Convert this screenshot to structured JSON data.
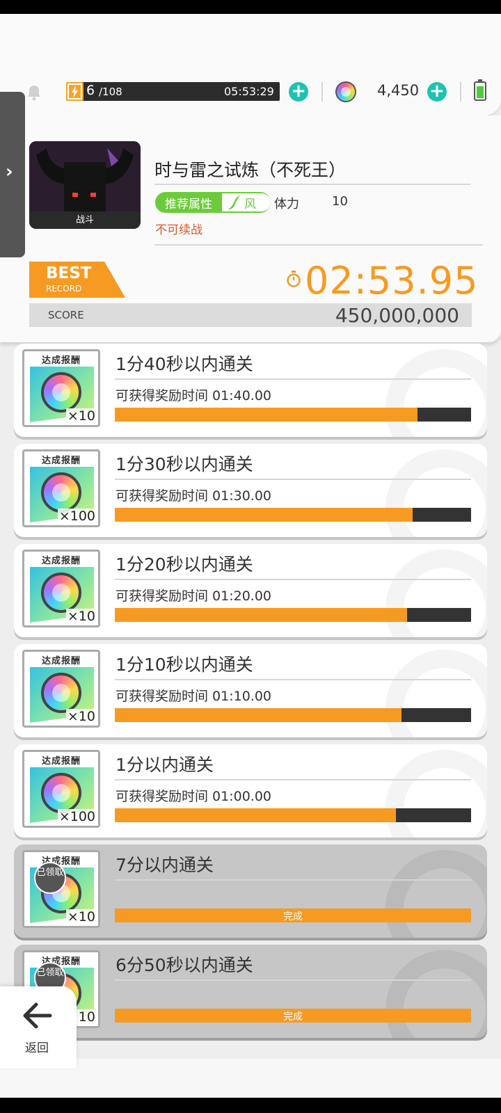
{
  "topbar": {
    "stamina_current": "6",
    "stamina_max": "/108",
    "stamina_timer": "05:53:29",
    "gems": "4,450"
  },
  "stage": {
    "thumbnail_caption": "战斗",
    "title": "时与雷之试炼（不死王）",
    "recommended_attr_label": "推荐属性",
    "recommended_attr_value": "风",
    "stamina_label": "体力",
    "stamina_cost": "10",
    "continue_notice": "不可续战"
  },
  "best": {
    "badge_line1": "BEST",
    "badge_line2": "RECORD",
    "time": "02:53.95",
    "score_label": "SCORE",
    "score": "450,000,000"
  },
  "missions": [
    {
      "reward_header": "达成报酬",
      "qty": "×10",
      "title": "1分40秒以内通关",
      "sub": "可获得奖励时间 01:40.00",
      "progress": 0.85,
      "done": false
    },
    {
      "reward_header": "达成报酬",
      "qty": "×100",
      "title": "1分30秒以内通关",
      "sub": "可获得奖励时间 01:30.00",
      "progress": 0.835,
      "done": false
    },
    {
      "reward_header": "达成报酬",
      "qty": "×10",
      "title": "1分20秒以内通关",
      "sub": "可获得奖励时间 01:20.00",
      "progress": 0.82,
      "done": false
    },
    {
      "reward_header": "达成报酬",
      "qty": "×10",
      "title": "1分10秒以内通关",
      "sub": "可获得奖励时间 01:10.00",
      "progress": 0.805,
      "done": false
    },
    {
      "reward_header": "达成报酬",
      "qty": "×100",
      "title": "1分以内通关",
      "sub": "可获得奖励时间 01:00.00",
      "progress": 0.79,
      "done": false
    },
    {
      "reward_header": "达成报酬",
      "qty": "×10",
      "title": "7分以内通关",
      "sub": "",
      "progress": 1,
      "done": true,
      "claimed_badge": "已领取",
      "done_label": "完成"
    },
    {
      "reward_header": "达成报酬",
      "qty": "×10",
      "title": "6分50秒以内通关",
      "sub": "",
      "progress": 1,
      "done": true,
      "claimed_badge": "已领取",
      "done_label": "完成"
    }
  ],
  "nav": {
    "back_label": "返回"
  },
  "colors": {
    "accent_orange": "#f79a22",
    "teal_plus": "#1fc2b0",
    "attr_green": "#6ccb3a",
    "warning_text": "#d35a2a"
  },
  "icons": [
    "bell-icon",
    "lightning-icon",
    "add-stamina-icon",
    "gem-orb-icon",
    "add-gems-icon",
    "battery-icon",
    "expand-chevron-icon",
    "wind-icon",
    "stopwatch-icon",
    "back-arrow-icon"
  ]
}
